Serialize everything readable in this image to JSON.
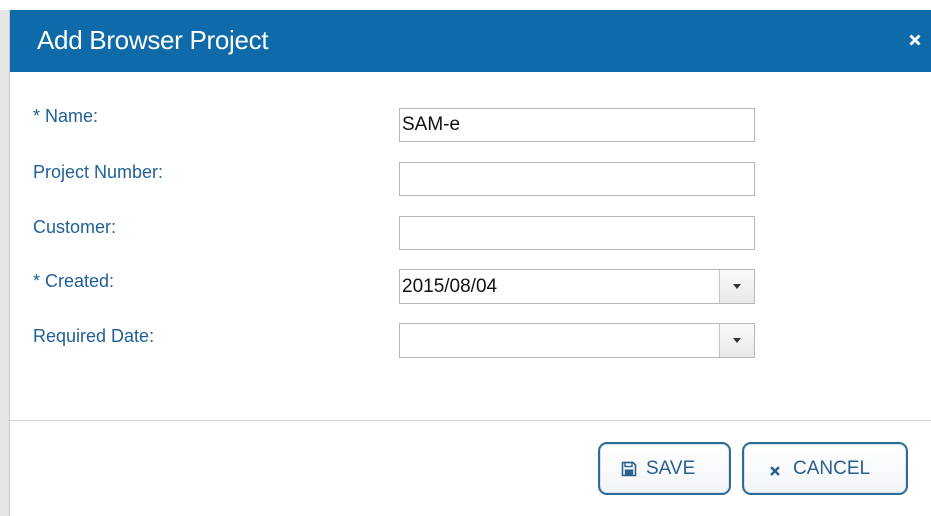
{
  "dialog": {
    "title": "Add Browser Project",
    "close_icon": "close-icon"
  },
  "form": {
    "name": {
      "label": "* Name:",
      "value": "SAM-e"
    },
    "project_number": {
      "label": "Project Number:",
      "value": ""
    },
    "customer": {
      "label": "Customer:",
      "value": ""
    },
    "created": {
      "label": "* Created:",
      "value": "2015/08/04",
      "dropdown_icon": "caret-down-icon"
    },
    "required_date": {
      "label": "Required Date:",
      "value": "",
      "dropdown_icon": "caret-down-icon"
    }
  },
  "footer": {
    "save_label": "SAVE",
    "save_icon": "floppy-disk-icon",
    "cancel_label": "CANCEL",
    "cancel_icon": "close-icon"
  },
  "colors": {
    "titlebar": "#0e6aa8",
    "label": "#1f5f97",
    "button_border": "#2e6b96",
    "button_text": "#2b5f8c"
  }
}
